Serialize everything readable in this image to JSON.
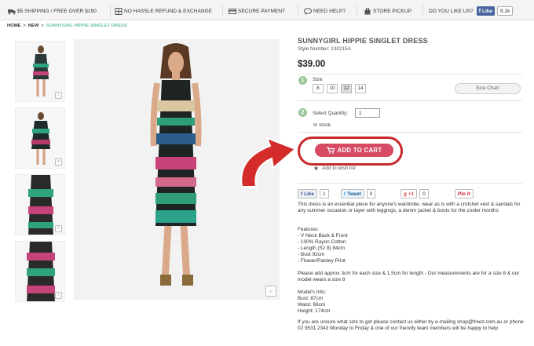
{
  "topbar": {
    "items": [
      {
        "label": "$5 SHIPPING / FREE OVER $150",
        "icon": "truck-icon"
      },
      {
        "label": "NO HASSLE REFUND & EXCHANGE",
        "icon": "grid-icon"
      },
      {
        "label": "SECURE PAYMENT",
        "icon": "card-icon"
      },
      {
        "label": "NEED HELP?",
        "icon": "chat-icon"
      },
      {
        "label": "STORE PICKUP",
        "icon": "bag-icon"
      }
    ],
    "like_prompt": "DO YOU LIKE US?",
    "fb_like_label": "Like",
    "fb_like_count": "8.2k"
  },
  "breadcrumb": [
    "HOME",
    "NEW",
    "SUNNYGIRL HIPPIE SINGLET DRESS"
  ],
  "breadcrumb_sep": ">",
  "product": {
    "title": "SUNNYGIRL HIPPIE SINGLET DRESS",
    "style_number": "Style Number: 130215A",
    "price": "$39.00",
    "step1": "1",
    "step2": "2",
    "size_label": "Size:",
    "sizes": [
      "8",
      "10",
      "12",
      "14"
    ],
    "selected_size": "12",
    "size_chart": "Size Chart",
    "quantity_label": "Select Quantity:",
    "quantity_value": "1",
    "stock_status": "In stock",
    "add_to_cart": "ADD TO CART",
    "wishlist": "Add to wish list"
  },
  "social": {
    "fb_like": "Like",
    "fb_count": "1",
    "tweet": "Tweet",
    "tweet_count": "0",
    "gplus": "+1",
    "gplus_count": "0",
    "pinit": "Pin it"
  },
  "description": {
    "intro": "This dress is an essential piece for anyone's wardrobe, wear as is with a crotchet vest & sandals for any summer occasion or layer with leggings, a denim jacket & boots for the cooler months",
    "features_title": "Features:",
    "features": [
      "- V Neck Back & Front",
      "- 100% Rayon Cotton",
      "- Length (Sz 8) 84cm",
      "- Bust 92cm",
      "- Flower/Paisley Print"
    ],
    "measurements_note": "Please add approx 3cm for each size & 1.5cm for length - Our measurements are for a size 8 & our model wears a size 8",
    "model_title": "Model's Info:",
    "model_info": [
      "Bust: 87cm",
      "Waist: 66cm",
      "Height: 174cm"
    ],
    "contact": "If you are unsure what size to get please contact us either by e-mailing shop@freez.com.au or phone 02 9531 2343 Monday to Friday & one of our friendly team members will be happy to help"
  },
  "colors": {
    "accent_green": "#6cc3a6",
    "cart_pink": "#d64a64",
    "arrow_red": "#d42b2b",
    "fb_blue": "#4a66a0"
  }
}
